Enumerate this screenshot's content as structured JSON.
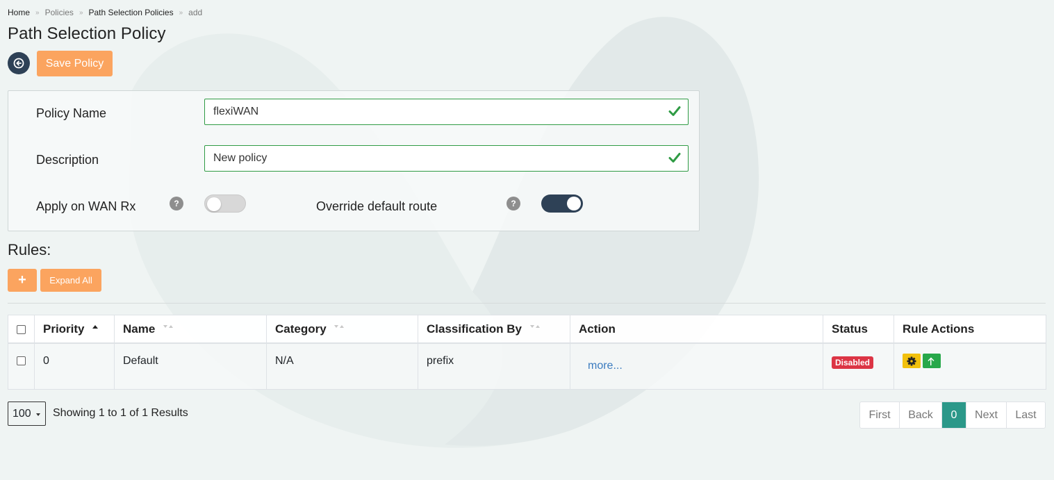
{
  "breadcrumb": [
    {
      "label": "Home"
    },
    {
      "label": "Policies"
    },
    {
      "label": "Path Selection Policies"
    },
    {
      "label": "add"
    }
  ],
  "breadcrumb_separator": "»",
  "page_title": "Path Selection Policy",
  "toolbar": {
    "back_icon": "arrow-left-circle-icon",
    "save_label": "Save Policy"
  },
  "form": {
    "policy_name": {
      "label": "Policy Name",
      "value": "flexiWAN"
    },
    "description": {
      "label": "Description",
      "value": "New policy"
    },
    "apply_wan_rx": {
      "label": "Apply on WAN Rx",
      "enabled": false,
      "help": "?"
    },
    "override_default_route": {
      "label": "Override default route",
      "enabled": true,
      "help": "?"
    }
  },
  "rules": {
    "heading": "Rules:",
    "add_label": "+",
    "expand_label": "Expand All",
    "columns": [
      "Priority",
      "Name",
      "Category",
      "Classification By",
      "Action",
      "Status",
      "Rule Actions"
    ],
    "rows": [
      {
        "priority": "0",
        "name": "Default",
        "category": "N/A",
        "classification": "prefix",
        "action": "more...",
        "status": "Disabled"
      }
    ]
  },
  "pagination": {
    "page_size": "100",
    "results_text": "Showing 1 to 1 of 1 Results",
    "buttons": [
      "First",
      "Back",
      "0",
      "Next",
      "Last"
    ],
    "active_page": "0"
  },
  "colors": {
    "accent_orange": "#fba45f",
    "navy": "#2e4156",
    "valid_green": "#2f9b44",
    "status_disabled": "#dc3545",
    "active_page": "#2b9889",
    "settings_yellow": "#f2c10d",
    "move_green": "#27a84a"
  }
}
